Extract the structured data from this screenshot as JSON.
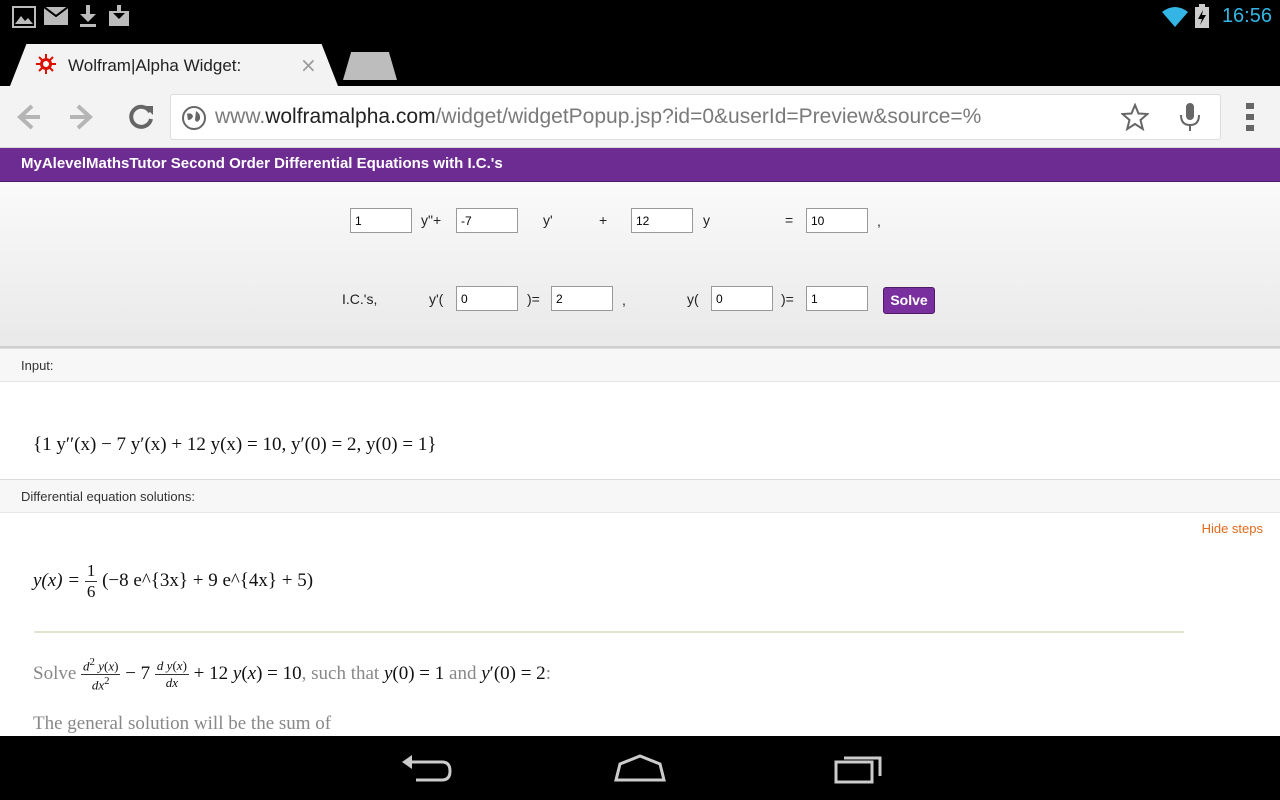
{
  "status_bar": {
    "clock": "16:56",
    "left_icons": [
      "gallery-icon",
      "gmail-icon",
      "download-icon",
      "download-box-icon"
    ],
    "right_icons": [
      "wifi-icon",
      "battery-charging-icon"
    ]
  },
  "browser": {
    "tab_title": "Wolfram|Alpha Widget:",
    "tab_close": "×",
    "url_scheme_host": "www.",
    "url_host": "wolframalpha.com",
    "url_path": "/widget/widgetPopup.jsp?id=0&userId=Preview&source=%"
  },
  "widget": {
    "title": "MyAlevelMathsTutor Second Order Differential Equations with I.C.'s",
    "row1": {
      "a_value": "1",
      "a_label": "y\"+",
      "b_value": "-7",
      "b_label": "y'",
      "plus": "+",
      "c_value": "12",
      "c_label": "y",
      "equals": "=",
      "rhs_value": "10",
      "comma": ","
    },
    "row2": {
      "ics_label": "I.C.'s,",
      "yp_open": "y'(",
      "yp_x_value": "0",
      "yp_close": ")=",
      "yp_value": "2",
      "comma": ",",
      "y_open": "y(",
      "y_x_value": "0",
      "y_close": ")=",
      "y_value": "1"
    },
    "solve_label": "Solve"
  },
  "pods": {
    "input_title": "Input:",
    "input_expr": "{1 y′′(x) − 7 y′(x) + 12 y(x) = 10, y′(0) = 2, y(0) = 1}",
    "solutions_title": "Differential equation solutions:",
    "hide_steps": "Hide steps",
    "solution_lhs": "y(x) =",
    "solution_frac_num": "1",
    "solution_frac_den": "6",
    "solution_rhs": "(−8 e^{3x} + 9 e^{4x} + 5)",
    "step_solve_word": "Solve",
    "step_such_that": ", such that",
    "step_and": "and",
    "step_text_end": ":",
    "step_general": "The general solution will be the sum of"
  }
}
